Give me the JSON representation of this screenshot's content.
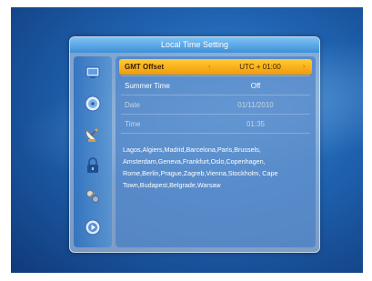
{
  "window": {
    "title": "Local Time Setting"
  },
  "sidebar": {
    "icons": [
      "monitor-icon",
      "disc-icon",
      "satellite-dish-icon",
      "lock-icon",
      "tools-icon",
      "media-player-icon"
    ]
  },
  "settings": {
    "gmt_offset": {
      "label": "GMT Offset",
      "value": "UTC + 01:00"
    },
    "summer_time": {
      "label": "Summer Time",
      "value": "Off"
    },
    "date": {
      "label": "Date",
      "value": "01/11/2010"
    },
    "time": {
      "label": "Time",
      "value": "01:35"
    }
  },
  "cities": "Lagos,Algiers,Madrid,Barcelona,Paris,Brussels, Amsterdam,Geneva,Frankfurt,Oslo,Copenhagen, Rome,Berlin,Prague,Zagreb,Vienna,Stockholm, Cape Town,Budapest,Belgrade,Warsaw",
  "colors": {
    "highlight": "#f29a0a",
    "titlebar": "#3f8fd6",
    "background": "#1f62b0"
  }
}
